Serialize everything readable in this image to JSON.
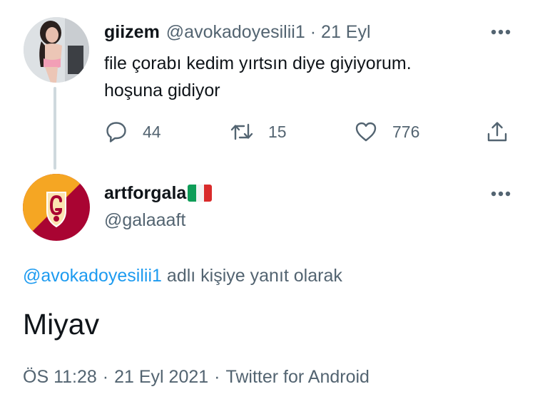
{
  "parent_tweet": {
    "author_name": "giizem",
    "author_handle": "@avokadoyesilii1",
    "separator": "·",
    "date": "21 Eyl",
    "text_line1": "file çorabı kedim yırtsın diye giyiyorum.",
    "text_line2": "hoşuna gidiyor",
    "reply_count": "44",
    "retweet_count": "15",
    "like_count": "776",
    "avatar_icon": "profile-photo"
  },
  "reply_tweet": {
    "author_name": "artforgala",
    "author_flag": "italy-flag-emoji",
    "author_handle": "@galaaaft",
    "replying_to_handle": "@avokadoyesilii1",
    "replying_to_suffix": "adlı kişiye yanıt olarak",
    "text": "Miyav",
    "time": "ÖS 11:28",
    "date": "21 Eyl 2021",
    "source": "Twitter for Android",
    "separator": "·",
    "avatar_icon": "galatasaray-logo"
  },
  "colors": {
    "text_primary": "#0f1419",
    "text_secondary": "#536471",
    "link": "#1d9bf0",
    "thread_line": "#cfd9de",
    "gs_yellow": "#f5a623",
    "gs_red": "#a90432"
  },
  "icons": {
    "more": "more-horizontal-icon",
    "reply": "reply-bubble-icon",
    "retweet": "retweet-icon",
    "like": "heart-icon",
    "share": "share-icon"
  }
}
